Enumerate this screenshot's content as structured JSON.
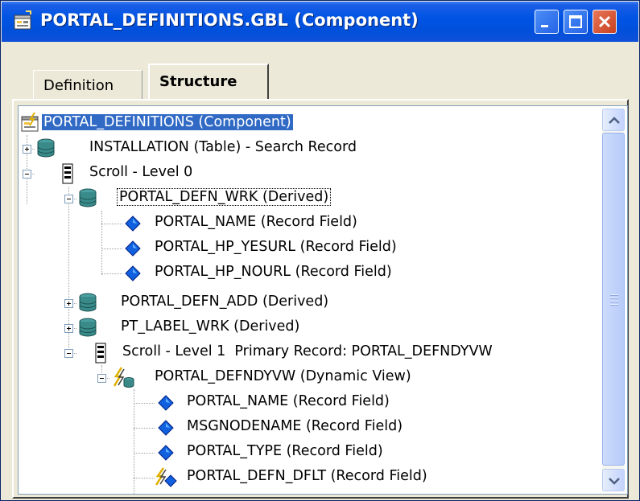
{
  "window": {
    "title": "PORTAL_DEFINITIONS.GBL (Component)"
  },
  "tabs": [
    {
      "label": "Definition",
      "active": false
    },
    {
      "label": "Structure",
      "active": true
    }
  ],
  "tree": {
    "items": [
      {
        "label": "PORTAL_DEFINITIONS (Component)",
        "icon": "component-icon",
        "selected": true
      },
      {
        "label": "INSTALLATION (Table) - Search Record",
        "icon": "table-record-icon",
        "expander": "plus"
      },
      {
        "label": "Scroll - Level 0",
        "icon": "scroll-level-icon",
        "expander": "minus"
      },
      {
        "label": "PORTAL_DEFN_WRK (Derived)",
        "icon": "derived-record-icon",
        "expander": "minus",
        "focused": true
      },
      {
        "label": "PORTAL_NAME (Record Field)",
        "icon": "record-field-icon"
      },
      {
        "label": "PORTAL_HP_YESURL (Record Field)",
        "icon": "record-field-icon"
      },
      {
        "label": "PORTAL_HP_NOURL (Record Field)",
        "icon": "record-field-icon"
      },
      {
        "label": "PORTAL_DEFN_ADD (Derived)",
        "icon": "derived-record-icon",
        "expander": "plus"
      },
      {
        "label": "PT_LABEL_WRK (Derived)",
        "icon": "derived-record-icon",
        "expander": "plus"
      },
      {
        "label": "Scroll - Level 1  Primary Record: PORTAL_DEFNDYVW",
        "icon": "scroll-level-icon",
        "expander": "minus"
      },
      {
        "label": "PORTAL_DEFNDYVW (Dynamic View)",
        "icon": "dynamic-view-icon",
        "expander": "minus"
      },
      {
        "label": "PORTAL_NAME (Record Field)",
        "icon": "record-field-icon"
      },
      {
        "label": "MSGNODENAME (Record Field)",
        "icon": "record-field-icon"
      },
      {
        "label": "PORTAL_TYPE (Record Field)",
        "icon": "record-field-icon"
      },
      {
        "label": "PORTAL_DEFN_DFLT (Record Field)",
        "icon": "default-field-icon"
      }
    ]
  },
  "colors": {
    "titlebar": "#0054e3",
    "selection": "#316ac5",
    "close_button": "#c7401e"
  }
}
